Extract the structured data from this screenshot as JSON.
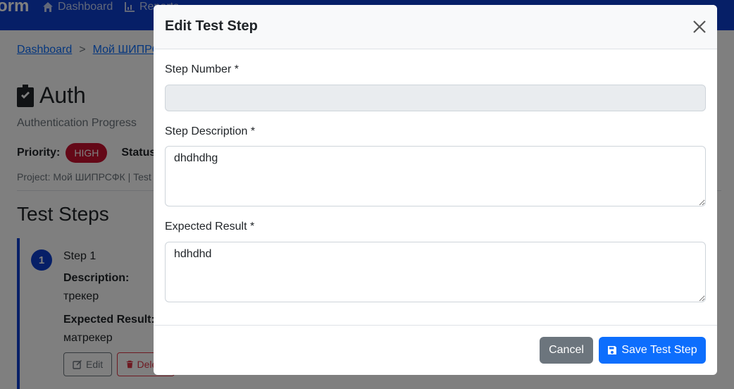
{
  "navbar": {
    "brand": "orm",
    "links": [
      {
        "label": "Dashboard",
        "icon": "home-icon"
      },
      {
        "label": "Reports",
        "icon": "chart-icon"
      }
    ]
  },
  "breadcrumb": {
    "items": [
      "Dashboard",
      "Мой ШИПРСФК"
    ],
    "separator": ">"
  },
  "test_case": {
    "title": "Auth",
    "description": "Authentication Progress",
    "priority_label": "Priority:",
    "priority_value": "HIGH",
    "status_label": "Status",
    "project_line": "Project: Мой ШИПРСФК | Test"
  },
  "steps_section": {
    "title": "Test Steps",
    "steps": [
      {
        "number": "1",
        "heading": "Step 1",
        "description_label": "Description:",
        "description": "трекер",
        "expected_label": "Expected Result:",
        "expected": "матрекер",
        "edit_label": "Edit",
        "delete_label": "Delete"
      }
    ]
  },
  "modal": {
    "title": "Edit Test Step",
    "fields": {
      "step_number": {
        "label": "Step Number *",
        "value": ""
      },
      "step_description": {
        "label": "Step Description *",
        "value": "dhdhdhg"
      },
      "expected_result": {
        "label": "Expected Result *",
        "value": "hdhdhd"
      }
    },
    "cancel_label": "Cancel",
    "save_label": "Save Test Step"
  },
  "colors": {
    "navbar": "#0d3fcf",
    "primary": "#0d6efd",
    "secondary": "#6c757d",
    "danger": "#c8102e"
  }
}
